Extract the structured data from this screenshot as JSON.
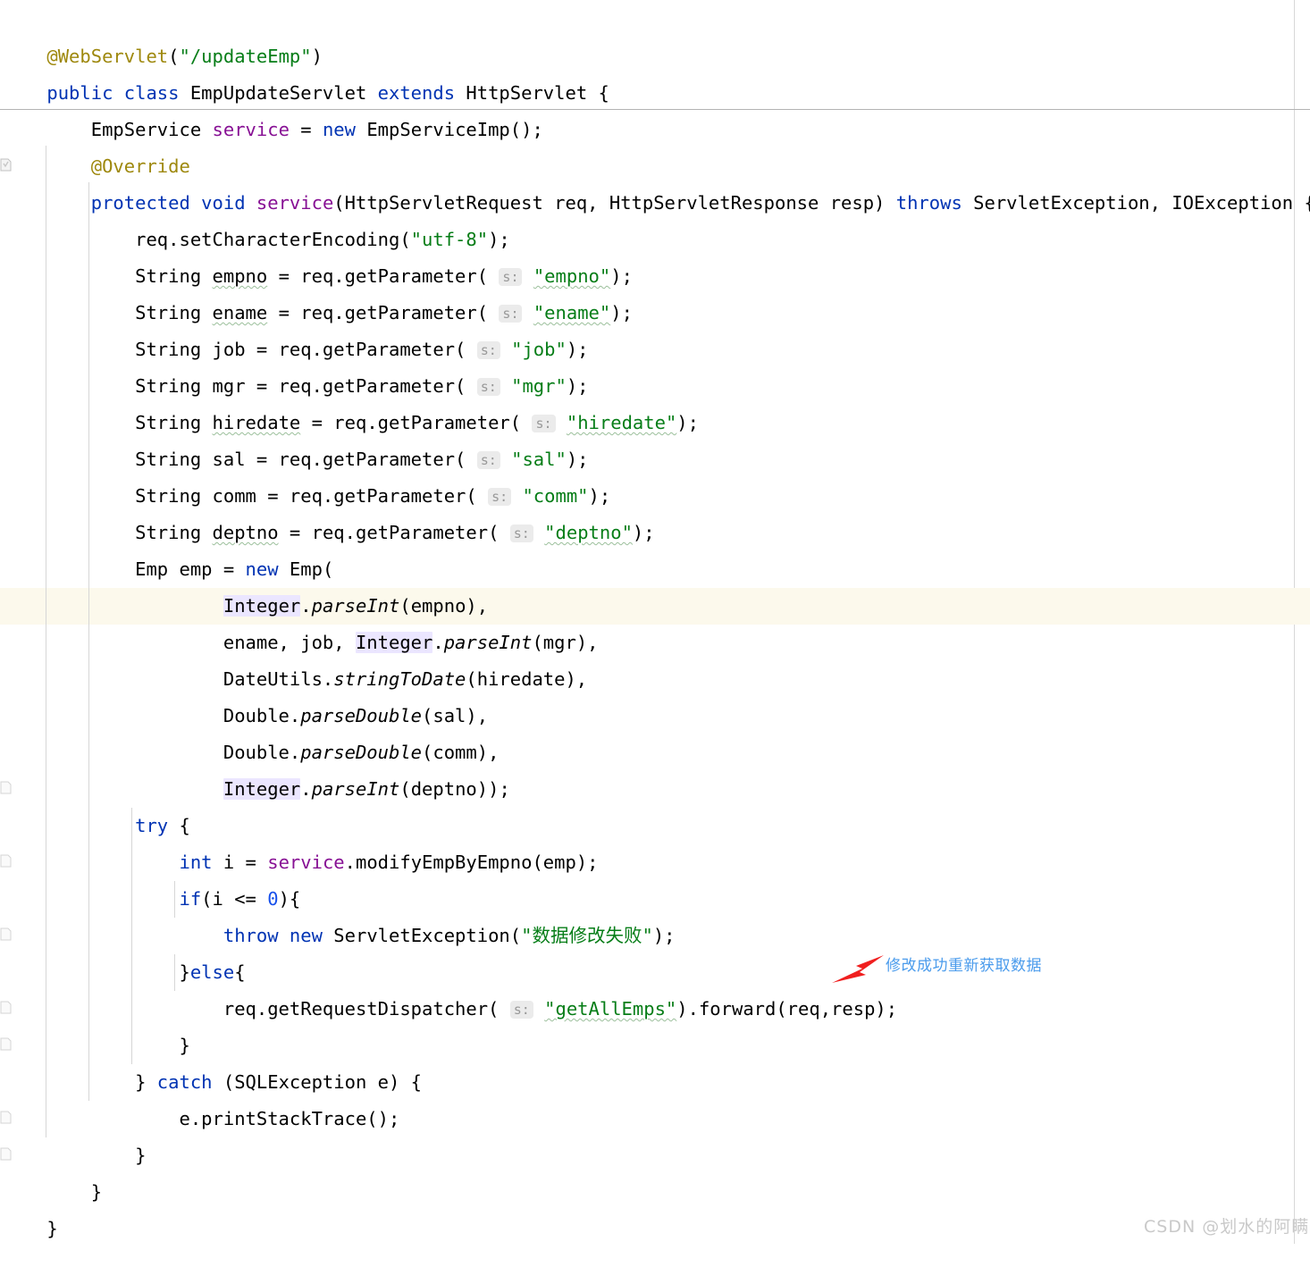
{
  "editor": {
    "language": "java",
    "theme": "IntelliJ Light",
    "background_color": "#ffffff",
    "caret_line_color": "#fcf9ec",
    "identifier_highlight_color": "#ebe6ff",
    "indent_guide_color": "#d6d6d6",
    "margin_guide_color": "#d8d8d8",
    "member_separator_color": "#b3b3b3",
    "colors": {
      "keyword": "#0033b3",
      "string": "#067d17",
      "annotation": "#9e880d",
      "field": "#871094",
      "number": "#1750eb",
      "plain": "#000000",
      "hint_text": "#999999",
      "hint_background": "#ebebeb",
      "typo_underline": "#9bbf9b"
    },
    "lines": [
      {
        "n": 1,
        "text": "@WebServlet(\"/updateEmp\")"
      },
      {
        "n": 2,
        "text": "public class EmpUpdateServlet extends HttpServlet {"
      },
      {
        "n": 3,
        "text": "    EmpService service = new EmpServiceImp();"
      },
      {
        "n": 4,
        "text": "    @Override"
      },
      {
        "n": 5,
        "text": "    protected void service(HttpServletRequest req, HttpServletResponse resp) throws ServletException, IOException {"
      },
      {
        "n": 6,
        "text": "        req.setCharacterEncoding(\"utf-8\");"
      },
      {
        "n": 7,
        "text": "        String empno = req.getParameter( s: \"empno\");"
      },
      {
        "n": 8,
        "text": "        String ename = req.getParameter( s: \"ename\");"
      },
      {
        "n": 9,
        "text": "        String job = req.getParameter( s: \"job\");"
      },
      {
        "n": 10,
        "text": "        String mgr = req.getParameter( s: \"mgr\");"
      },
      {
        "n": 11,
        "text": "        String hiredate = req.getParameter( s: \"hiredate\");"
      },
      {
        "n": 12,
        "text": "        String sal = req.getParameter( s: \"sal\");"
      },
      {
        "n": 13,
        "text": "        String comm = req.getParameter( s: \"comm\");"
      },
      {
        "n": 14,
        "text": "        String deptno = req.getParameter( s: \"deptno\");"
      },
      {
        "n": 15,
        "text": "        Emp emp = new Emp("
      },
      {
        "n": 16,
        "text": "                Integer.parseInt(empno),"
      },
      {
        "n": 17,
        "text": "                ename, job, Integer.parseInt(mgr),"
      },
      {
        "n": 18,
        "text": "                DateUtils.stringToDate(hiredate),"
      },
      {
        "n": 19,
        "text": "                Double.parseDouble(sal),"
      },
      {
        "n": 20,
        "text": "                Double.parseDouble(comm),"
      },
      {
        "n": 21,
        "text": "                Integer.parseInt(deptno));"
      },
      {
        "n": 22,
        "text": "        try {"
      },
      {
        "n": 23,
        "text": "            int i = service.modifyEmpByEmpno(emp);"
      },
      {
        "n": 24,
        "text": "            if(i <= 0){"
      },
      {
        "n": 25,
        "text": "                throw new ServletException(\"数据修改失败\");"
      },
      {
        "n": 26,
        "text": "            }else{"
      },
      {
        "n": 27,
        "text": "                req.getRequestDispatcher( s: \"getAllEmps\").forward(req,resp);"
      },
      {
        "n": 28,
        "text": "            }"
      },
      {
        "n": 29,
        "text": "        } catch (SQLException e) {"
      },
      {
        "n": 30,
        "text": "            e.printStackTrace();"
      },
      {
        "n": 31,
        "text": "        }"
      },
      {
        "n": 32,
        "text": "    }"
      },
      {
        "n": 33,
        "text": "}"
      }
    ],
    "parameter_hints": [
      {
        "label": "s:",
        "lines": [
          7,
          8,
          9,
          10,
          11,
          12,
          13,
          14,
          27
        ]
      }
    ],
    "highlighted_identifier": "Integer",
    "caret_line_number": 17,
    "gutter_markers": [
      {
        "type": "override-method-icon",
        "line": 5
      },
      {
        "type": "fold-marker-icon",
        "line": 22
      },
      {
        "type": "fold-marker-icon",
        "line": 24
      },
      {
        "type": "fold-marker-icon",
        "line": 26
      },
      {
        "type": "fold-marker-icon",
        "line": 28
      },
      {
        "type": "fold-marker-icon",
        "line": 29
      },
      {
        "type": "fold-marker-icon",
        "line": 31
      },
      {
        "type": "fold-marker-icon",
        "line": 32
      }
    ]
  },
  "annotation": {
    "text": "修改成功重新获取数据",
    "text_color": "#4a9bec",
    "arrow_color": "#f01f1f",
    "arrow_direction": "up-right",
    "points_to_line": 27
  },
  "watermark": {
    "text": "CSDN @划水的阿瞒",
    "color": "#c9c9c9"
  }
}
